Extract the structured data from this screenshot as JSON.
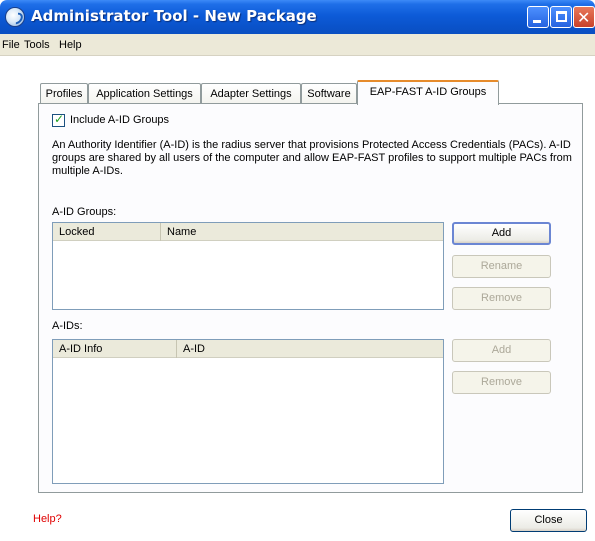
{
  "window": {
    "title": "Administrator Tool - New Package"
  },
  "menu": {
    "file": "File",
    "tools": "Tools",
    "help": "Help"
  },
  "tabs": [
    {
      "label": "Profiles"
    },
    {
      "label": "Application Settings"
    },
    {
      "label": "Adapter Settings"
    },
    {
      "label": "Software"
    },
    {
      "label": "EAP-FAST A-ID Groups",
      "active": true
    }
  ],
  "include_aid": {
    "label": "Include A-ID Groups",
    "checked": true
  },
  "description": "An Authority Identifier (A-ID) is the radius server that provisions Protected Access Credentials (PACs). A-ID groups are shared by all users of the computer and allow EAP-FAST profiles to support multiple PACs from multiple A-IDs.",
  "aid_groups": {
    "label": "A-ID Groups:",
    "columns": [
      "Locked",
      "Name"
    ],
    "buttons": {
      "add": "Add",
      "rename": "Rename",
      "remove": "Remove"
    }
  },
  "aids": {
    "label": "A-IDs:",
    "columns": [
      "A-ID Info",
      "A-ID"
    ],
    "buttons": {
      "add": "Add",
      "remove": "Remove"
    }
  },
  "footer": {
    "help": "Help?",
    "close": "Close"
  }
}
